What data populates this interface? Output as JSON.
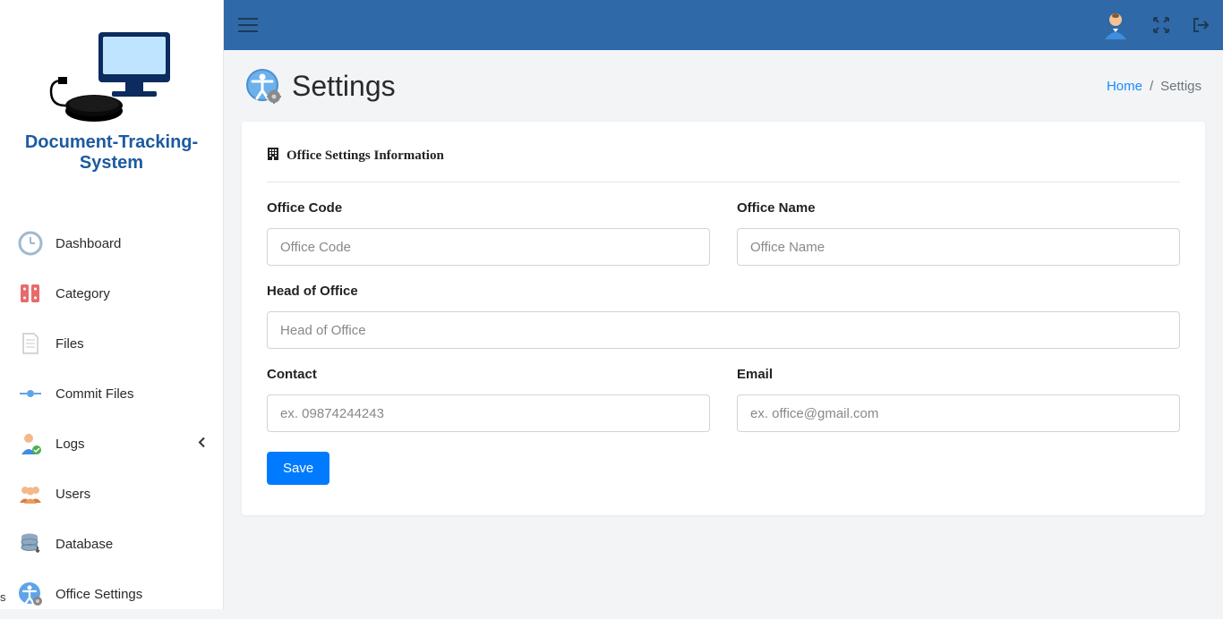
{
  "app_name": "Document-Tracking-System",
  "sidebar": {
    "items": [
      {
        "label": "Dashboard"
      },
      {
        "label": "Category"
      },
      {
        "label": "Files"
      },
      {
        "label": "Commit Files"
      },
      {
        "label": "Logs"
      },
      {
        "label": "Users"
      },
      {
        "label": "Database"
      },
      {
        "label": "Office Settings"
      }
    ]
  },
  "page": {
    "title": "Settings",
    "card_title": "Office Settings Information"
  },
  "breadcrumb": {
    "home": "Home",
    "sep": "/",
    "current": "Settigs"
  },
  "form": {
    "office_code_label": "Office Code",
    "office_code_placeholder": "Office Code",
    "office_name_label": "Office Name",
    "office_name_placeholder": "Office Name",
    "head_label": "Head of Office",
    "head_placeholder": "Head of Office",
    "contact_label": "Contact",
    "contact_placeholder": "ex. 09874244243",
    "email_label": "Email",
    "email_placeholder": "ex. office@gmail.com",
    "save_label": "Save"
  },
  "stray_text": "s"
}
